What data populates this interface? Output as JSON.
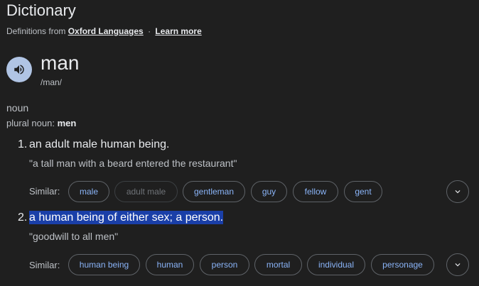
{
  "header": {
    "title": "Dictionary",
    "source_prefix": "Definitions from",
    "source_link": "Oxford Languages",
    "separator": "·",
    "learn_more": "Learn more"
  },
  "entry": {
    "word": "man",
    "phonetic": "/man/",
    "part_of_speech": "noun",
    "plural_label": "plural noun:",
    "plural_value": "men"
  },
  "definitions": [
    {
      "number": "1.",
      "text": "an adult male human being.",
      "example": "\"a tall man with a beard entered the restaurant\"",
      "similar_label": "Similar:",
      "similar": [
        "male",
        "adult male",
        "gentleman",
        "guy",
        "fellow",
        "gent"
      ]
    },
    {
      "number": "2.",
      "text": "a human being of either sex; a person.",
      "example": "\"goodwill to all men\"",
      "similar_label": "Similar:",
      "similar": [
        "human being",
        "human",
        "person",
        "mortal",
        "individual",
        "personage"
      ]
    }
  ],
  "colors": {
    "background": "#1f1f1f",
    "link_chip": "#8ab4f8",
    "highlight": "#1a3fa8",
    "speaker_button": "#b0c4e4"
  },
  "icons": {
    "speaker": "speaker-icon",
    "expand": "chevron-down-icon"
  }
}
